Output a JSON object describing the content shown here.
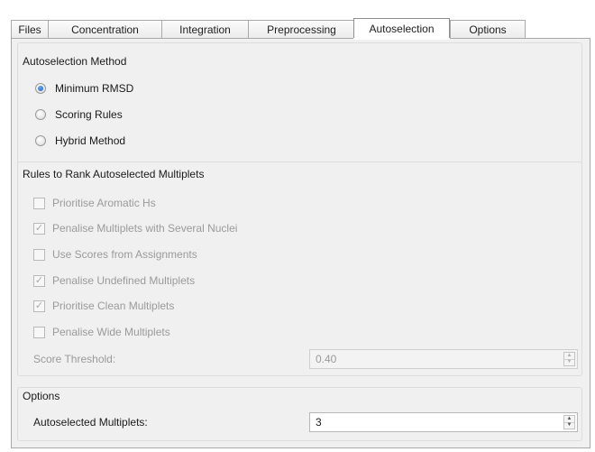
{
  "tabs": [
    {
      "label": "Files"
    },
    {
      "label": "Concentration"
    },
    {
      "label": "Integration"
    },
    {
      "label": "Preprocessing"
    },
    {
      "label": "Autoselection"
    },
    {
      "label": "Options"
    }
  ],
  "active_tab": "Autoselection",
  "method_group": {
    "title": "Autoselection Method",
    "options": [
      {
        "label": "Minimum RMSD",
        "selected": true
      },
      {
        "label": "Scoring Rules",
        "selected": false
      },
      {
        "label": "Hybrid Method",
        "selected": false
      }
    ]
  },
  "rules_group": {
    "title": "Rules to Rank Autoselected Multiplets",
    "enabled": false,
    "rules": [
      {
        "label": "Prioritise Aromatic Hs",
        "checked": false
      },
      {
        "label": "Penalise Multiplets with Several  Nuclei",
        "checked": true
      },
      {
        "label": "Use Scores from Assignments",
        "checked": false
      },
      {
        "label": "Penalise Undefined Multiplets",
        "checked": true
      },
      {
        "label": "Prioritise Clean Multiplets",
        "checked": true
      },
      {
        "label": "Penalise Wide Multiplets",
        "checked": false
      }
    ],
    "threshold_label": "Score Threshold:",
    "threshold_value": "0.40"
  },
  "options_group": {
    "title": "Options",
    "multiplets_label": "Autoselected Multiplets:",
    "multiplets_value": "3"
  },
  "icons": {
    "spin_up": "▲",
    "spin_down": "▼",
    "check": "✓"
  }
}
